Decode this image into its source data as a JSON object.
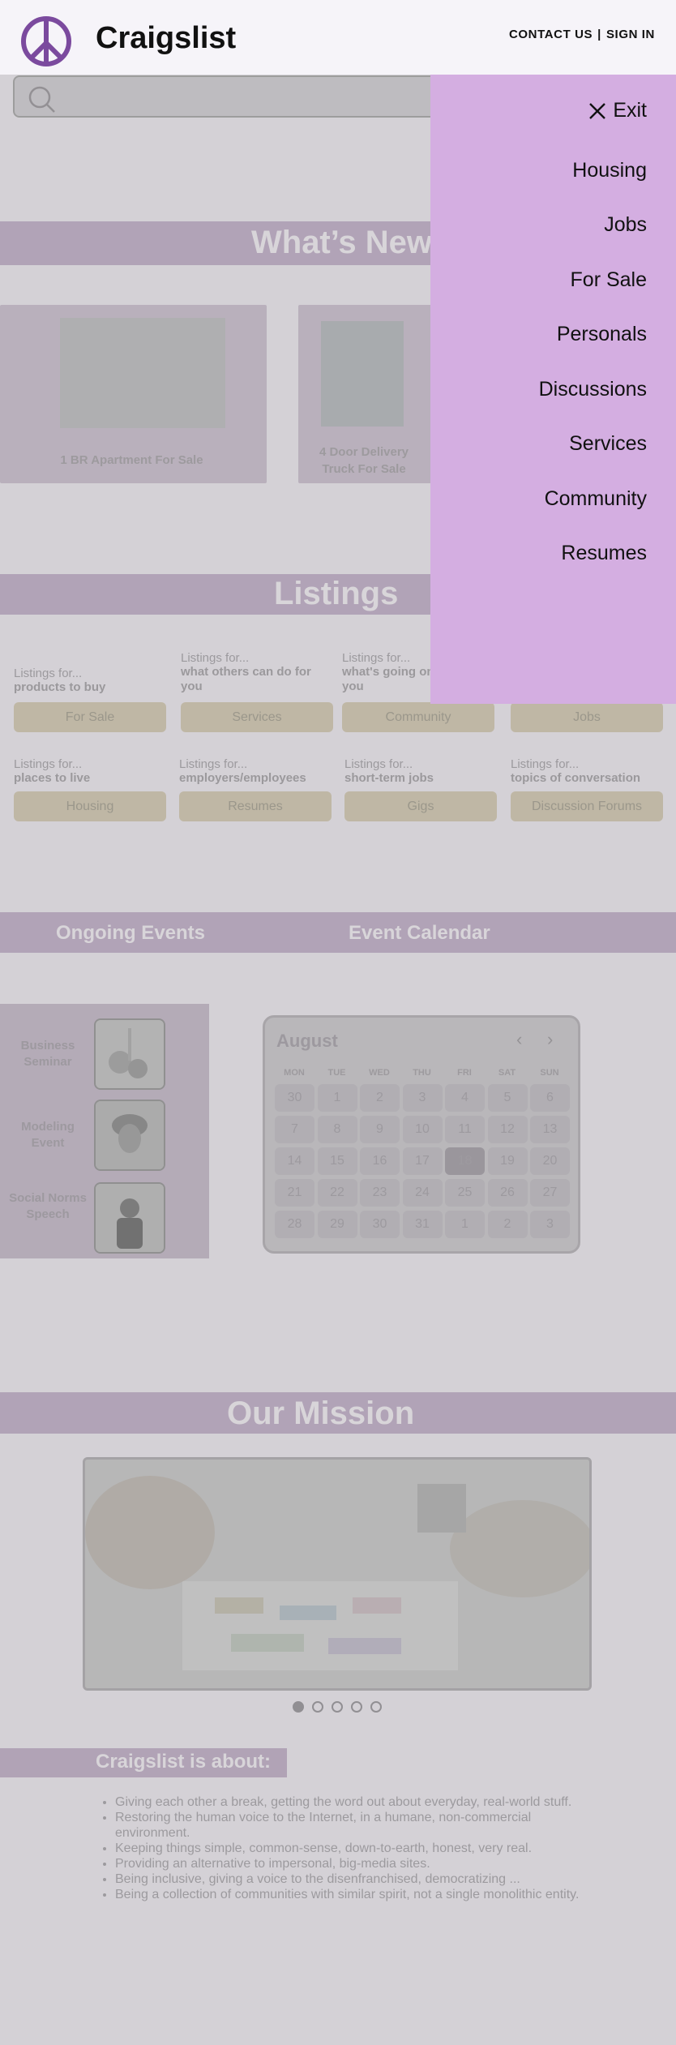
{
  "header": {
    "brand": "Craigslist",
    "logo_icon": "peace-sign-icon",
    "contact_label": "CONTACT US",
    "separator": "|",
    "signin_label": "SIGN IN",
    "accent_color": "#7b4a9e"
  },
  "search": {
    "placeholder": "",
    "icon": "search-icon"
  },
  "whats_new": {
    "title": "What’s New",
    "items": [
      {
        "caption": "1 BR Apartment For Sale"
      },
      {
        "caption": "4 Door Delivery Truck For Sale"
      }
    ]
  },
  "listings": {
    "title": "Listings",
    "items": [
      {
        "prefix": "Listings for...",
        "subject": "products to buy",
        "button": "For Sale"
      },
      {
        "prefix": "Listings for...",
        "subject": "what others can do for you",
        "button": "Services"
      },
      {
        "prefix": "Listings for...",
        "subject": "what's going on around you",
        "button": "Community"
      },
      {
        "prefix": "",
        "subject": "",
        "button": "Jobs"
      },
      {
        "prefix": "Listings for...",
        "subject": "places to live",
        "button": "Housing"
      },
      {
        "prefix": "Listings for...",
        "subject": "employers/employees",
        "button": "Resumes"
      },
      {
        "prefix": "Listings for...",
        "subject": "short-term jobs",
        "button": "Gigs"
      },
      {
        "prefix": "Listings for...",
        "subject": "topics of conversation",
        "button": "Discussion Forums"
      }
    ]
  },
  "events": {
    "ongoing_title": "Ongoing Events",
    "calendar_title": "Event Calendar",
    "items": [
      {
        "name": "Business Seminar"
      },
      {
        "name": "Modeling Event"
      },
      {
        "name": "Social Norms Speech"
      }
    ]
  },
  "calendar": {
    "month": "August",
    "prev_icon": "chevron-left-icon",
    "next_icon": "chevron-right-icon",
    "weekdays": [
      "MON",
      "TUE",
      "WED",
      "THU",
      "FRI",
      "SAT",
      "SUN"
    ],
    "days": [
      "30",
      "1",
      "2",
      "3",
      "4",
      "5",
      "6",
      "7",
      "8",
      "9",
      "10",
      "11",
      "12",
      "13",
      "14",
      "15",
      "16",
      "17",
      "18",
      "19",
      "20",
      "21",
      "22",
      "23",
      "24",
      "25",
      "26",
      "27",
      "28",
      "29",
      "30",
      "31",
      "1",
      "2",
      "3"
    ],
    "selected_day": "18"
  },
  "mission": {
    "title": "Our Mission",
    "slides_total": 5,
    "active_slide": 1
  },
  "about": {
    "title": "Craigslist is about:",
    "points": [
      "Giving each other a break, getting the word out about everyday, real-world stuff.",
      "Restoring the human voice to the Internet, in a humane, non-commercial environment.",
      "Keeping things simple, common-sense, down-to-earth, honest, very real.",
      "Providing an alternative to impersonal, big-media sites.",
      "Being inclusive, giving a voice to the disenfranchised, democratizing ...",
      "Being a collection of communities with similar spirit, not a single monolithic entity."
    ]
  },
  "drawer": {
    "exit_label": "Exit",
    "exit_icon": "close-icon",
    "items": [
      "Housing",
      "Jobs",
      "For Sale",
      "Personals",
      "Discussions",
      "Services",
      "Community",
      "Resumes"
    ],
    "background": "#d4aee1"
  }
}
